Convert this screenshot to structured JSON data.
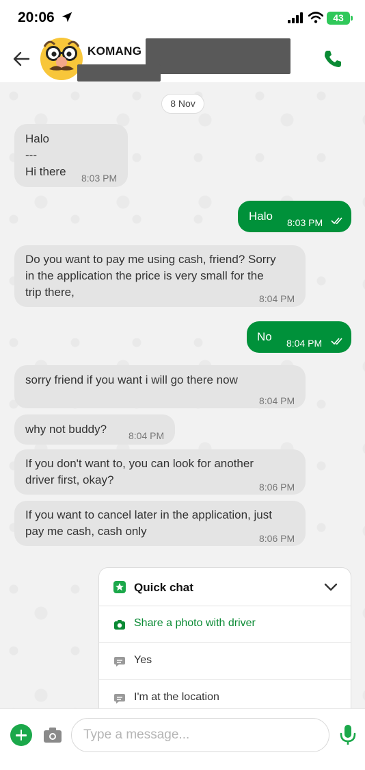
{
  "status_bar": {
    "time": "20:06",
    "battery": "43"
  },
  "header": {
    "contact_name": "KOMANG",
    "avatar_icon": "disguised-face-emoji",
    "back_icon": "arrow-left-icon",
    "call_icon": "phone-icon"
  },
  "chat": {
    "date_label": "8 Nov",
    "messages": [
      {
        "dir": "in",
        "text": "Halo\n---\nHi there",
        "time": "8:03 PM"
      },
      {
        "dir": "out",
        "text": "Halo",
        "time": "8:03 PM",
        "read": true
      },
      {
        "dir": "in",
        "text": "Do you want to pay me using cash, friend? Sorry\nin the application the price is very small for the\ntrip there,",
        "time": "8:04 PM"
      },
      {
        "dir": "out",
        "text": "No",
        "time": "8:04 PM",
        "read": true
      },
      {
        "dir": "in",
        "text": "sorry friend if you want i will go there now",
        "time": "8:04 PM"
      },
      {
        "dir": "in",
        "text": "why not buddy?",
        "time": "8:04 PM"
      },
      {
        "dir": "in",
        "text": "If you don't want to, you can look for another\ndriver first, okay?",
        "time": "8:06 PM"
      },
      {
        "dir": "in",
        "text": "If you want to cancel later in the application, just\npay me cash, cash only",
        "time": "8:06 PM"
      }
    ]
  },
  "quick_chat": {
    "title": "Quick chat",
    "items": [
      {
        "label": "Share a photo with driver",
        "icon": "camera-icon",
        "accent": "#0a8a34"
      },
      {
        "label": "Yes",
        "icon": "message-icon"
      },
      {
        "label": "I'm at the location",
        "icon": "message-icon"
      }
    ]
  },
  "composer": {
    "placeholder": "Type a message..."
  },
  "colors": {
    "brand_green": "#00913a",
    "incoming_bubble": "#e4e4e4",
    "battery_green": "#30c85a"
  }
}
